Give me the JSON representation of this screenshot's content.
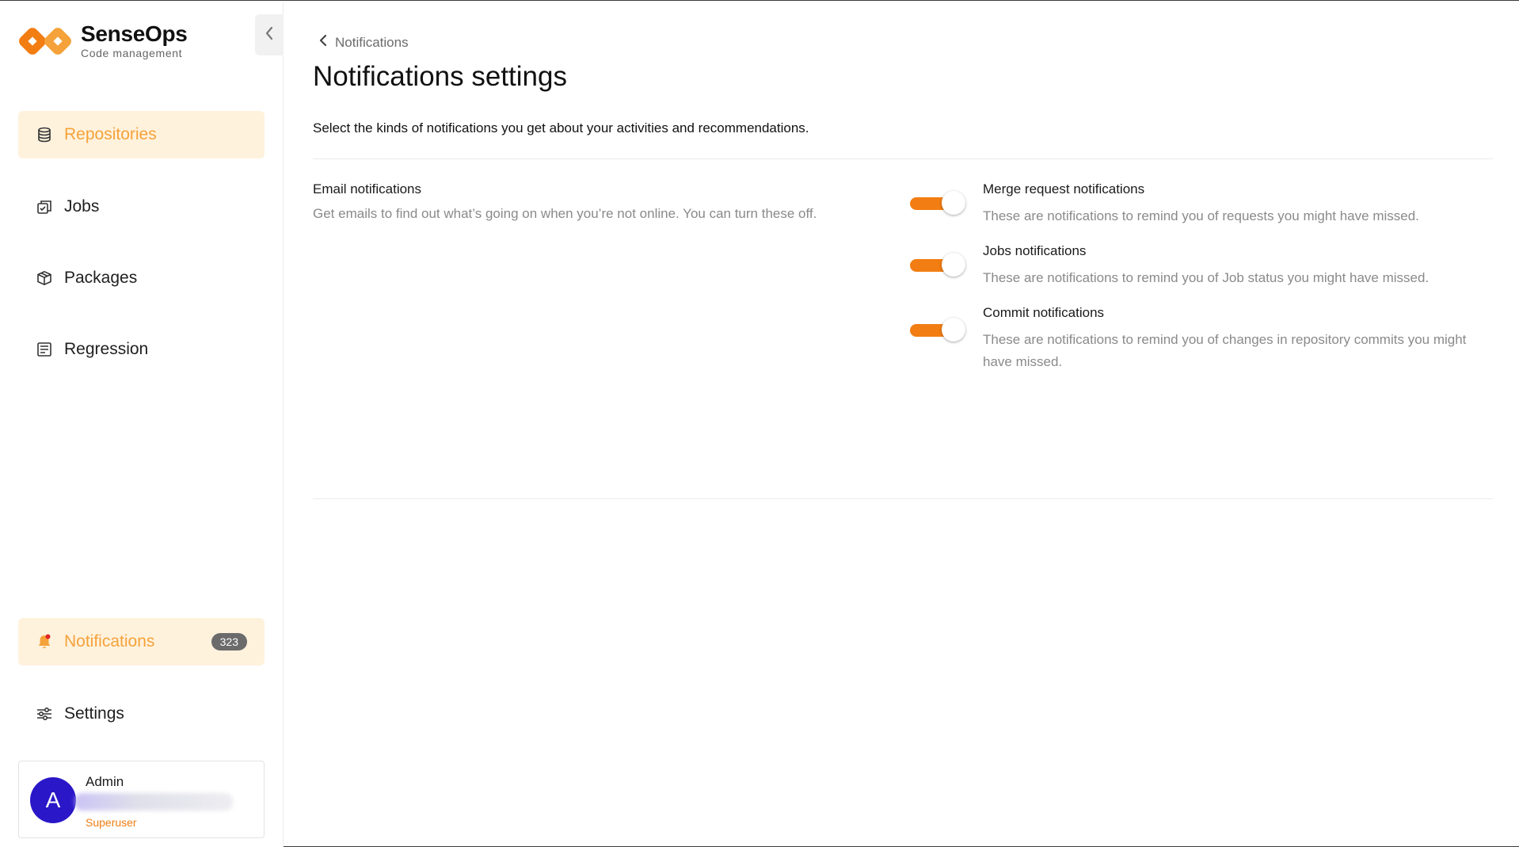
{
  "brand": {
    "name": "SenseOps",
    "tagline": "Code management",
    "accent_color": "#f27d12",
    "accent_light": "#fff2dd"
  },
  "sidebar": {
    "collapse_icon": "chevron-left-icon",
    "items": [
      {
        "label": "Repositories",
        "icon": "database-icon",
        "active": true
      },
      {
        "label": "Jobs",
        "icon": "jobs-icon",
        "active": false
      },
      {
        "label": "Packages",
        "icon": "package-icon",
        "active": false
      },
      {
        "label": "Regression",
        "icon": "regression-icon",
        "active": false
      }
    ],
    "bottom_items": [
      {
        "label": "Notifications",
        "icon": "bell-icon",
        "active": true,
        "badge": "323"
      },
      {
        "label": "Settings",
        "icon": "sliders-icon",
        "active": false
      }
    ],
    "user": {
      "initial": "A",
      "name": "Admin",
      "role": "Superuser"
    }
  },
  "main": {
    "breadcrumb": "Notifications",
    "title": "Notifications settings",
    "description": "Select the kinds of notifications you get about your activities and recommendations.",
    "email_section": {
      "title": "Email notifications",
      "hint": "Get emails to find out what’s going on when you’re not online. You can turn these off."
    },
    "toggles": [
      {
        "title": "Merge request notifications",
        "desc": "These are notifications to remind you of requests you might have missed.",
        "enabled": true
      },
      {
        "title": "Jobs notifications",
        "desc": "These are notifications to remind you of Job status you might have missed.",
        "enabled": true
      },
      {
        "title": "Commit notifications",
        "desc": "These are notifications to remind you of changes in repository commits you might have missed.",
        "enabled": true
      }
    ]
  }
}
